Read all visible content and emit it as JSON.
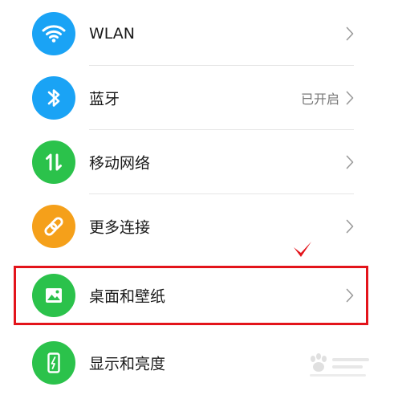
{
  "settings": {
    "items": [
      {
        "label": "WLAN",
        "status": "",
        "icon": "wifi-icon",
        "color": "#1aa3f5"
      },
      {
        "label": "蓝牙",
        "status": "已开启",
        "icon": "bluetooth-icon",
        "color": "#1aa3f5"
      },
      {
        "label": "移动网络",
        "status": "",
        "icon": "mobile-network-icon",
        "color": "#2bc24b"
      },
      {
        "label": "更多连接",
        "status": "",
        "icon": "link-icon",
        "color": "#f5a01a"
      },
      {
        "label": "桌面和壁纸",
        "status": "",
        "icon": "picture-icon",
        "color": "#2bc24b"
      },
      {
        "label": "显示和亮度",
        "status": "",
        "icon": "phone-brightness-icon",
        "color": "#2bc24b"
      }
    ]
  },
  "annotation": {
    "highlight_color": "#e3141b",
    "highlighted_item": "桌面和壁纸"
  }
}
